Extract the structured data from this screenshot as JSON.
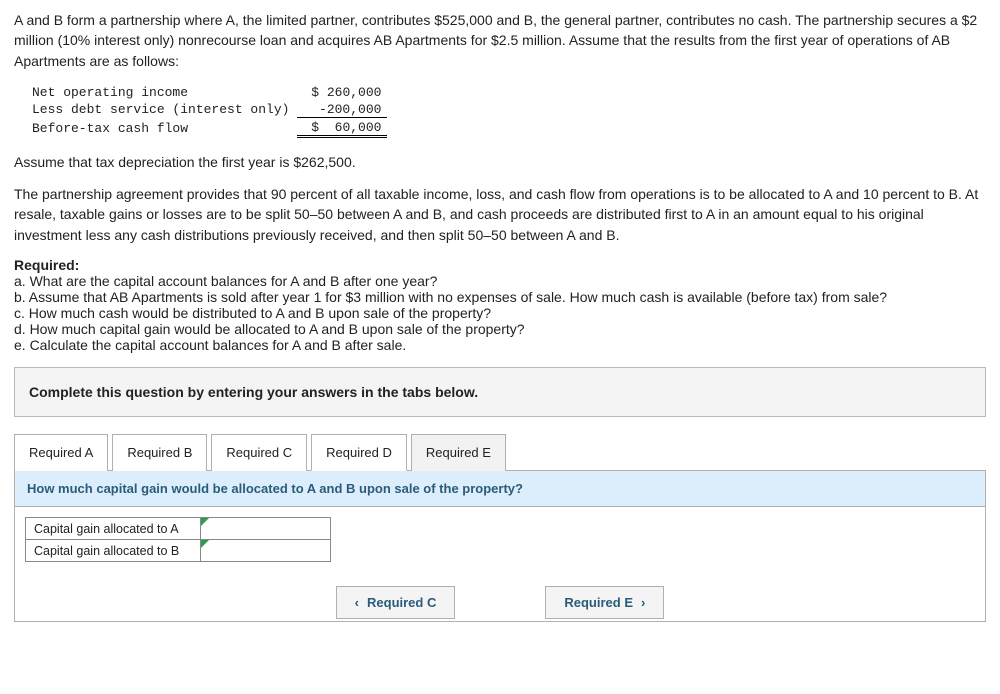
{
  "problem": {
    "intro": "A and B form a partnership where A, the limited partner, contributes $525,000 and B, the general partner, contributes no cash. The partnership secures a $2 million (10% interest only) nonrecourse loan and acquires AB Apartments for $2.5 million. Assume that the results from the first year of operations of AB Apartments are as follows:",
    "income_rows": {
      "noi_label": "Net operating income",
      "noi_value": "$ 260,000",
      "debt_label": "Less debt service (interest only)",
      "debt_value": "-200,000",
      "btcf_label": "Before-tax cash flow",
      "btcf_value": "$  60,000"
    },
    "depr": "Assume that tax depreciation the first year is $262,500.",
    "agreement": "The partnership agreement provides that 90 percent of all taxable income, loss, and cash flow from operations is to be allocated to A and 10 percent to B. At  resale, taxable gains or losses are to be split 50–50 between A and B, and cash proceeds are distributed first to A in an amount equal to his original investment less  any cash distributions previously received, and then split 50–50 between A and B.",
    "required_heading": "Required:",
    "req_a": "a. What are the capital account balances for A and B after one year?",
    "req_b": "b. Assume that AB Apartments is sold after year 1 for $3 million with no expenses of sale. How much cash is available (before tax) from sale?",
    "req_c": "c. How much cash would be distributed to A and B upon sale of the property?",
    "req_d": "d. How much capital gain would be allocated to A and B upon sale of the property?",
    "req_e": "e. Calculate the capital account balances for A and B after sale."
  },
  "answer_box": {
    "instruction": "Complete this question by entering your answers in the tabs below."
  },
  "tabs": {
    "a": "Required A",
    "b": "Required B",
    "c": "Required C",
    "d": "Required D",
    "e": "Required E"
  },
  "panel": {
    "question": "How much capital gain would be allocated to A and B upon sale of the property?",
    "rows": {
      "a_label": "Capital gain allocated to A",
      "b_label": "Capital gain allocated to B"
    }
  },
  "nav": {
    "prev": "Required C",
    "next": "Required E"
  },
  "chart_data": {
    "type": "table",
    "title": "First-year operations of AB Apartments",
    "rows": [
      {
        "label": "Net operating income",
        "value": 260000
      },
      {
        "label": "Less debt service (interest only)",
        "value": -200000
      },
      {
        "label": "Before-tax cash flow",
        "value": 60000
      }
    ],
    "tax_depreciation_year1": 262500
  }
}
